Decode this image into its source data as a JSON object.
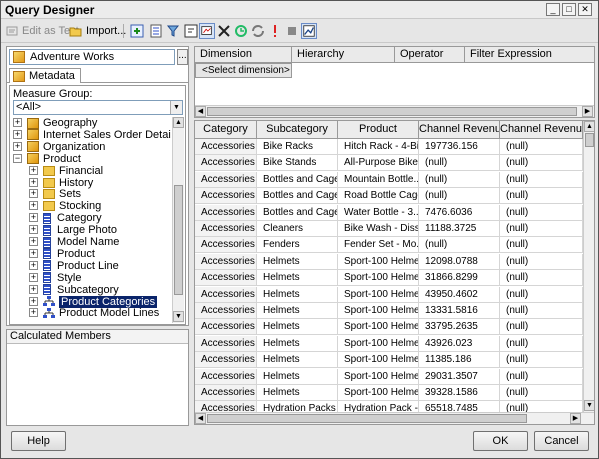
{
  "window": {
    "title": "Query Designer",
    "minimize": "_",
    "maximize": "□",
    "close": "✕"
  },
  "toolbar": {
    "edit_as_text": "Edit as Text",
    "import": "Import..."
  },
  "cube_selector": {
    "value": "Adventure Works",
    "browse_label": "..."
  },
  "metadata_tab": {
    "label": "Metadata"
  },
  "measure_group": {
    "label": "Measure Group:",
    "value": "<All>"
  },
  "tree": [
    {
      "label": "Geography",
      "icon": "dimension-icon",
      "expander": "+",
      "level": 0
    },
    {
      "label": "Internet Sales Order Details",
      "icon": "dimension-icon",
      "expander": "+",
      "level": 0
    },
    {
      "label": "Organization",
      "icon": "dimension-icon",
      "expander": "+",
      "level": 0
    },
    {
      "label": "Product",
      "icon": "dimension-icon",
      "expander": "−",
      "level": 0
    },
    {
      "label": "Financial",
      "icon": "folder-icon",
      "expander": "+",
      "level": 1
    },
    {
      "label": "History",
      "icon": "folder-icon",
      "expander": "+",
      "level": 1
    },
    {
      "label": "Sets",
      "icon": "folder-icon",
      "expander": "+",
      "level": 1
    },
    {
      "label": "Stocking",
      "icon": "folder-icon",
      "expander": "+",
      "level": 1
    },
    {
      "label": "Category",
      "icon": "attribute-icon",
      "expander": "+",
      "level": 1
    },
    {
      "label": "Large Photo",
      "icon": "attribute-icon",
      "expander": "+",
      "level": 1
    },
    {
      "label": "Model Name",
      "icon": "attribute-icon",
      "expander": "+",
      "level": 1
    },
    {
      "label": "Product",
      "icon": "attribute-icon",
      "expander": "+",
      "level": 1
    },
    {
      "label": "Product Line",
      "icon": "attribute-icon",
      "expander": "+",
      "level": 1
    },
    {
      "label": "Style",
      "icon": "attribute-icon",
      "expander": "+",
      "level": 1
    },
    {
      "label": "Subcategory",
      "icon": "attribute-icon",
      "expander": "+",
      "level": 1
    },
    {
      "label": "Product Categories",
      "icon": "hierarchy-icon",
      "expander": "+",
      "level": 1,
      "selected": true
    },
    {
      "label": "Product Model Lines",
      "icon": "hierarchy-icon",
      "expander": "+",
      "level": 1
    }
  ],
  "calculated_members": {
    "header": "Calculated Members"
  },
  "filter": {
    "headers": [
      "Dimension",
      "Hierarchy",
      "Operator",
      "Filter Expression"
    ],
    "placeholder": "<Select dimension>"
  },
  "grid": {
    "headers": [
      "Category",
      "Subcategory",
      "Product",
      "Channel Revenu...",
      "Channel Revenu..."
    ],
    "rows": [
      [
        "Accessories",
        "Bike Racks",
        "Hitch Rack - 4-Bi...",
        "197736.156",
        "(null)"
      ],
      [
        "Accessories",
        "Bike Stands",
        "All-Purpose Bike...",
        "(null)",
        "(null)"
      ],
      [
        "Accessories",
        "Bottles and Cages",
        "Mountain Bottle...",
        "(null)",
        "(null)"
      ],
      [
        "Accessories",
        "Bottles and Cages",
        "Road Bottle Cage",
        "(null)",
        "(null)"
      ],
      [
        "Accessories",
        "Bottles and Cages",
        "Water Bottle - 3...",
        "7476.6036",
        "(null)"
      ],
      [
        "Accessories",
        "Cleaners",
        "Bike Wash - Diss...",
        "11188.3725",
        "(null)"
      ],
      [
        "Accessories",
        "Fenders",
        "Fender Set - Mo...",
        "(null)",
        "(null)"
      ],
      [
        "Accessories",
        "Helmets",
        "Sport-100 Helme...",
        "12098.0788",
        "(null)"
      ],
      [
        "Accessories",
        "Helmets",
        "Sport-100 Helme...",
        "31866.8299",
        "(null)"
      ],
      [
        "Accessories",
        "Helmets",
        "Sport-100 Helme...",
        "43950.4602",
        "(null)"
      ],
      [
        "Accessories",
        "Helmets",
        "Sport-100 Helme...",
        "13331.5816",
        "(null)"
      ],
      [
        "Accessories",
        "Helmets",
        "Sport-100 Helme...",
        "33795.2635",
        "(null)"
      ],
      [
        "Accessories",
        "Helmets",
        "Sport-100 Helme...",
        "43926.023",
        "(null)"
      ],
      [
        "Accessories",
        "Helmets",
        "Sport-100 Helme...",
        "11385.186",
        "(null)"
      ],
      [
        "Accessories",
        "Helmets",
        "Sport-100 Helme...",
        "29031.3507",
        "(null)"
      ],
      [
        "Accessories",
        "Helmets",
        "Sport-100 Helme...",
        "39328.1586",
        "(null)"
      ],
      [
        "Accessories",
        "Hydration Packs",
        "Hydration Pack -...",
        "65518.7485",
        "(null)"
      ]
    ]
  },
  "footer": {
    "help": "Help",
    "ok": "OK",
    "cancel": "Cancel"
  }
}
